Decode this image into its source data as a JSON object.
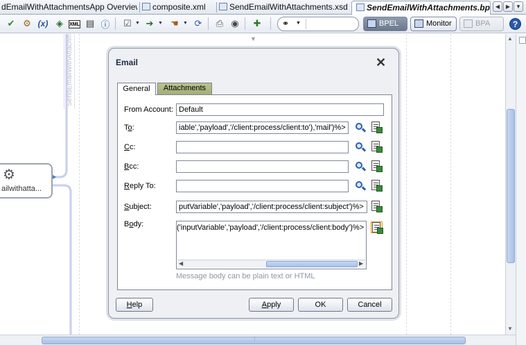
{
  "tabs": [
    {
      "label": "dEmailWithAttachmentsApp Overview"
    },
    {
      "label": "composite.xml"
    },
    {
      "label": "SendEmailWithAttachments.xsd"
    },
    {
      "label": "SendEmailWithAttachments.bpel"
    }
  ],
  "toolbar": {
    "variables_label": "(x)",
    "xml_label": "XML",
    "bpel_label": "BPEL",
    "monitor_label": "Monitor",
    "bpa_label": "BPA",
    "help_label": "?"
  },
  "canvas": {
    "vertical_label": "SendEmailWithAttachments",
    "activity_label": "ailwithatta..."
  },
  "dialog": {
    "title": "Email",
    "tabs": {
      "general": "General",
      "attachments": "Attachments"
    },
    "fields": {
      "from_account": {
        "label": "From Account:",
        "value": "Default"
      },
      "to": {
        "label_prefix": "T",
        "label_mn": "o",
        "label_suffix": ":",
        "value": "iable','payload','/client:process/client:to'),'mail')%>"
      },
      "cc": {
        "label_prefix": "",
        "label_mn": "C",
        "label_suffix": "c:",
        "value": ""
      },
      "bcc": {
        "label_prefix": "",
        "label_mn": "B",
        "label_suffix": "cc:",
        "value": ""
      },
      "reply_to": {
        "label_prefix": "",
        "label_mn": "R",
        "label_suffix": "eply To:",
        "value": ""
      },
      "subject": {
        "label_prefix": "",
        "label_mn": "S",
        "label_suffix": "ubject:",
        "value": "putVariable','payload','/client:process/client:subject')%>"
      },
      "body": {
        "label_prefix": "B",
        "label_mn": "o",
        "label_suffix": "dy:",
        "value": "('inputVariable','payload','/client:process/client:body')%>"
      }
    },
    "hint": "Message body can be plain text or HTML",
    "buttons": {
      "help": {
        "mn": "H",
        "rest": "elp"
      },
      "apply": {
        "mn": "A",
        "rest": "pply"
      },
      "ok": "OK",
      "cancel": "Cancel"
    }
  }
}
